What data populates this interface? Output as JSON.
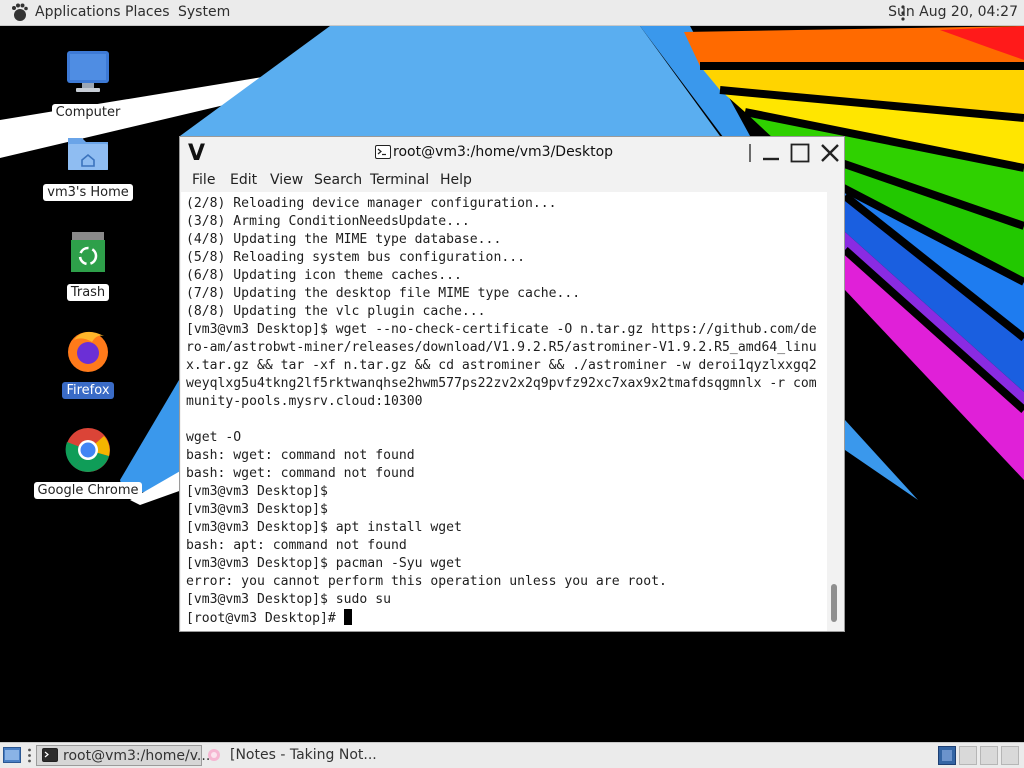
{
  "top_panel": {
    "menus": [
      "Applications",
      "Places",
      "System"
    ],
    "clock": "Sun Aug 20, 04:27"
  },
  "desktop": {
    "icons": [
      {
        "label": "Computer",
        "icon": "computer-icon"
      },
      {
        "label": "vm3's Home",
        "icon": "home-folder-icon"
      },
      {
        "label": "Trash",
        "icon": "trash-icon"
      },
      {
        "label": "Firefox",
        "icon": "firefox-icon",
        "selected": true
      },
      {
        "label": "Google Chrome",
        "icon": "chrome-icon"
      }
    ]
  },
  "terminal": {
    "title": "root@vm3:/home/vm3/Desktop",
    "menu": [
      "File",
      "Edit",
      "View",
      "Search",
      "Terminal",
      "Help"
    ],
    "lines": [
      "(2/8) Reloading device manager configuration...",
      "(3/8) Arming ConditionNeedsUpdate...",
      "(4/8) Updating the MIME type database...",
      "(5/8) Reloading system bus configuration...",
      "(6/8) Updating icon theme caches...",
      "(7/8) Updating the desktop file MIME type cache...",
      "(8/8) Updating the vlc plugin cache...",
      "[vm3@vm3 Desktop]$ wget --no-check-certificate -O n.tar.gz https://github.com/de",
      "ro-am/astrobwt-miner/releases/download/V1.9.2.R5/astrominer-V1.9.2.R5_amd64_linu",
      "x.tar.gz && tar -xf n.tar.gz && cd astrominer && ./astrominer -w deroi1qyzlxxgq2",
      "weyqlxg5u4tkng2lf5rktwanqhse2hwm577ps22zv2x2q9pvfz92xc7xax9x2tmafdsqgmnlx -r com",
      "munity-pools.mysrv.cloud:10300",
      "",
      "wget -O",
      "bash: wget: command not found",
      "bash: wget: command not found",
      "[vm3@vm3 Desktop]$",
      "[vm3@vm3 Desktop]$",
      "[vm3@vm3 Desktop]$ apt install wget",
      "bash: apt: command not found",
      "[vm3@vm3 Desktop]$ pacman -Syu wget",
      "error: you cannot perform this operation unless you are root.",
      "[vm3@vm3 Desktop]$ sudo su"
    ],
    "prompt": "[root@vm3 Desktop]# "
  },
  "taskbar": {
    "tasks": [
      {
        "label": "root@vm3:/home/v...",
        "icon": "terminal-icon",
        "active": true
      },
      {
        "label": "[Notes - Taking Not...",
        "icon": "notes-icon",
        "active": false
      }
    ],
    "workspaces": 4,
    "active_workspace": 1
  },
  "colors": {
    "panel": "#ebebeb",
    "selection": "#3a6bc6",
    "workspace_active": "#3465a4"
  }
}
